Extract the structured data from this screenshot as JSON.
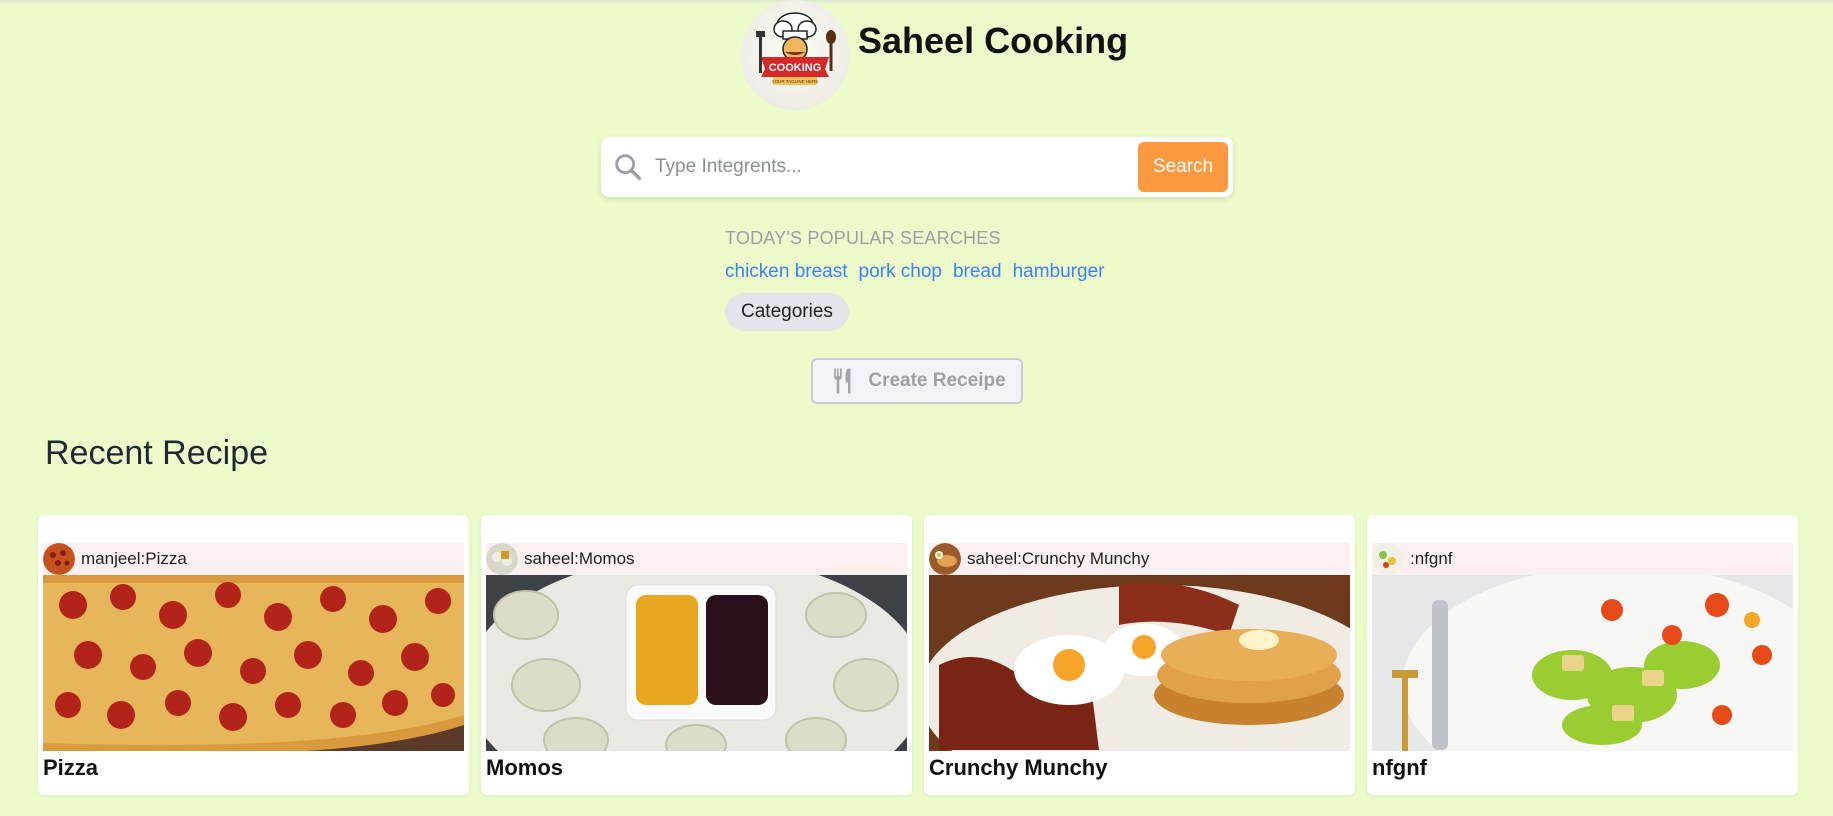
{
  "header": {
    "brand_title": "Saheel Cooking",
    "logo_text": "COOKING",
    "logo_tagline": "YOUR TAGLINE HERE"
  },
  "search": {
    "placeholder": "Type Integrents...",
    "value": "",
    "button_label": "Search",
    "button_color": "#fd9a40"
  },
  "popular": {
    "heading": "TODAY'S POPULAR SEARCHES",
    "links": [
      "chicken breast",
      "pork chop",
      "bread",
      "hamburger"
    ],
    "categories_label": "Categories"
  },
  "create": {
    "label": "Create Receipe",
    "icon": "fork-knife-icon"
  },
  "recent": {
    "title": "Recent Recipe",
    "cards": [
      {
        "author_line": "manjeel:Pizza",
        "title": "Pizza",
        "image": "pizza"
      },
      {
        "author_line": "saheel:Momos",
        "title": "Momos",
        "image": "momos"
      },
      {
        "author_line": "saheel:Crunchy Munchy",
        "title": "Crunchy Munchy",
        "image": "breakfast"
      },
      {
        "author_line": ":nfgnf",
        "title": "nfgnf",
        "image": "salad"
      }
    ]
  },
  "colors": {
    "background": "#ecfbc9",
    "link": "#3b82f6",
    "accent": "#fd9a40"
  }
}
